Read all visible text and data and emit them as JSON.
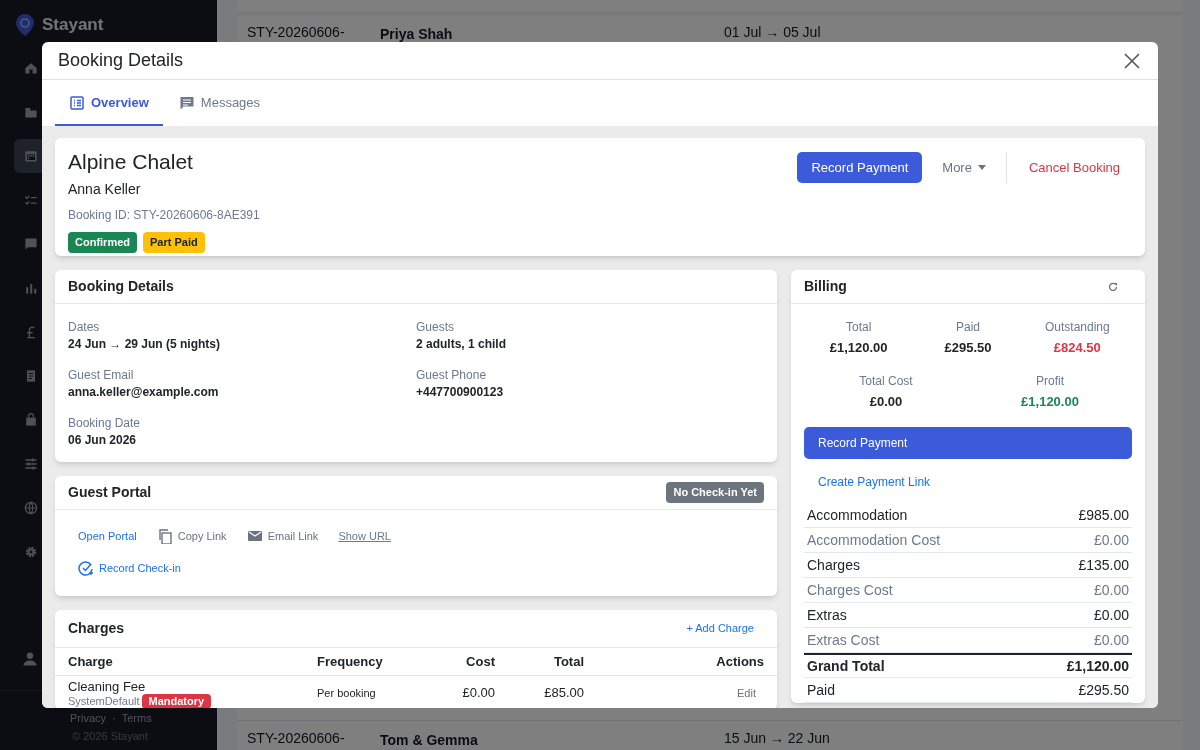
{
  "sidebar": {
    "brand": "Stayant",
    "nav": [
      {
        "selected": false
      },
      {
        "selected": false
      },
      {
        "selected": true
      },
      {
        "selected": false
      },
      {
        "selected": false
      },
      {
        "selected": false
      },
      {
        "selected": false
      },
      {
        "selected": false
      },
      {
        "selected": false
      },
      {
        "selected": false
      },
      {
        "selected": false
      },
      {
        "selected": false
      }
    ],
    "links": [
      "Privacy",
      "Terms"
    ],
    "link_separator": "·",
    "copyright": "© 2026 Stayant"
  },
  "background_rows": [
    {
      "reference": "STY-20260606-",
      "guest": "Priya Shah",
      "dates": "01 Jul → 05 Jul"
    },
    {
      "reference": "STY-20260606-",
      "guest": "Tom & Gemma",
      "dates": "15 Jun → 22 Jun"
    }
  ],
  "modal": {
    "title": "Booking Details",
    "tabs": [
      {
        "label": "Overview",
        "selected": true
      },
      {
        "label": "Messages",
        "selected": false
      }
    ],
    "summary": {
      "property": "Alpine Chalet",
      "guest": "Anna Keller",
      "booking_id": "Booking ID: STY-20260606-8AE391",
      "badges": [
        {
          "label": "Confirmed",
          "color": "#198754"
        },
        {
          "label": "Part Paid",
          "color": "#ffc107"
        }
      ],
      "record_payment": "Record Payment",
      "more": "More",
      "cancel": "Cancel Booking"
    },
    "details": {
      "title": "Booking Details",
      "fields": [
        {
          "label": "Dates",
          "value": "24 Jun → 29 Jun (5 nights)"
        },
        {
          "label": "Guests",
          "value": "2 adults, 1 child"
        },
        {
          "label": "Guest Email",
          "value": "anna.keller@example.com"
        },
        {
          "label": "Guest Phone",
          "value": "+447700900123"
        },
        {
          "label": "Booking Date",
          "value": "06 Jun 2026"
        }
      ]
    },
    "guest_portal": {
      "title": "Guest Portal",
      "status": "No Check-in Yet",
      "actions": [
        {
          "label": "Open Portal",
          "kind": "open"
        },
        {
          "label": "Copy Link",
          "kind": "copy"
        },
        {
          "label": "Email Link",
          "kind": "email"
        },
        {
          "label": "Show URL",
          "kind": "url"
        },
        {
          "label": "Record Check-in",
          "kind": "checkin"
        }
      ]
    },
    "charges": {
      "title": "Charges",
      "add": "+ Add Charge",
      "columns": [
        "Charge",
        "Frequency",
        "Cost",
        "Total",
        "Actions"
      ],
      "rows": [
        {
          "charge": "Cleaning Fee",
          "source": "SystemDefault",
          "tag": "Mandatory",
          "frequency": "Per booking",
          "cost": "£0.00",
          "total": "£85.00",
          "action": "Edit"
        }
      ]
    },
    "billing": {
      "title": "Billing",
      "summary": [
        {
          "label": "Total",
          "value": "£1,120.00",
          "color": "#212529"
        },
        {
          "label": "Paid",
          "value": "£295.50",
          "color": "#212529"
        },
        {
          "label": "Outstanding",
          "value": "£824.50",
          "color": "#dc3545"
        },
        {
          "label": "Total Cost",
          "value": "£0.00",
          "color": "#212529"
        },
        {
          "label": "Profit",
          "value": "£1,120.00",
          "color": "#198754"
        }
      ],
      "record_payment": "Record Payment",
      "payment_link": "Create Payment Link",
      "lines": [
        {
          "label": "Accommodation",
          "value": "£985.00",
          "kind": "item"
        },
        {
          "label": "Accommodation Cost",
          "value": "£0.00",
          "kind": "cost"
        },
        {
          "label": "Charges",
          "value": "£135.00",
          "kind": "item"
        },
        {
          "label": "Charges Cost",
          "value": "£0.00",
          "kind": "cost"
        },
        {
          "label": "Extras",
          "value": "£0.00",
          "kind": "item"
        },
        {
          "label": "Extras Cost",
          "value": "£0.00",
          "kind": "cost"
        },
        {
          "label": "Grand Total",
          "value": "£1,120.00",
          "kind": "grand"
        },
        {
          "label": "Paid",
          "value": "£295.50",
          "kind": "item"
        }
      ]
    }
  }
}
